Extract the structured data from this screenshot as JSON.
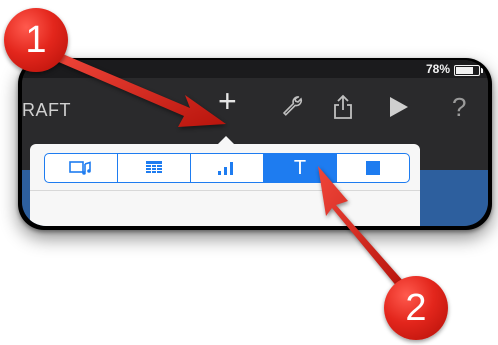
{
  "status_bar": {
    "battery_percent": "78%"
  },
  "toolbar": {
    "doc_title": "RAFT",
    "buttons": [
      {
        "name": "add",
        "icon": "plus-icon",
        "glyph": "+"
      },
      {
        "name": "tools",
        "icon": "wrench-icon",
        "glyph": "🔧"
      },
      {
        "name": "share",
        "icon": "share-icon",
        "glyph": "⇪"
      },
      {
        "name": "play",
        "icon": "play-icon",
        "glyph": "▶"
      },
      {
        "name": "help",
        "icon": "help-icon",
        "glyph": "?"
      }
    ]
  },
  "popover": {
    "segments": [
      {
        "icon": "media-icon",
        "glyph": "▭♫",
        "selected": false
      },
      {
        "icon": "table-icon",
        "glyph": "☷",
        "selected": false
      },
      {
        "icon": "chart-icon",
        "glyph": "▁▃▅",
        "selected": false
      },
      {
        "icon": "text-icon",
        "glyph": "T",
        "selected": true
      },
      {
        "icon": "shape-icon",
        "glyph": "■",
        "selected": false
      }
    ]
  },
  "callouts": [
    {
      "label": "1"
    },
    {
      "label": "2"
    }
  ],
  "colors": {
    "accent": "#1e7cf0",
    "callout": "#e3261c",
    "toolbar": "#2a2a2c"
  }
}
